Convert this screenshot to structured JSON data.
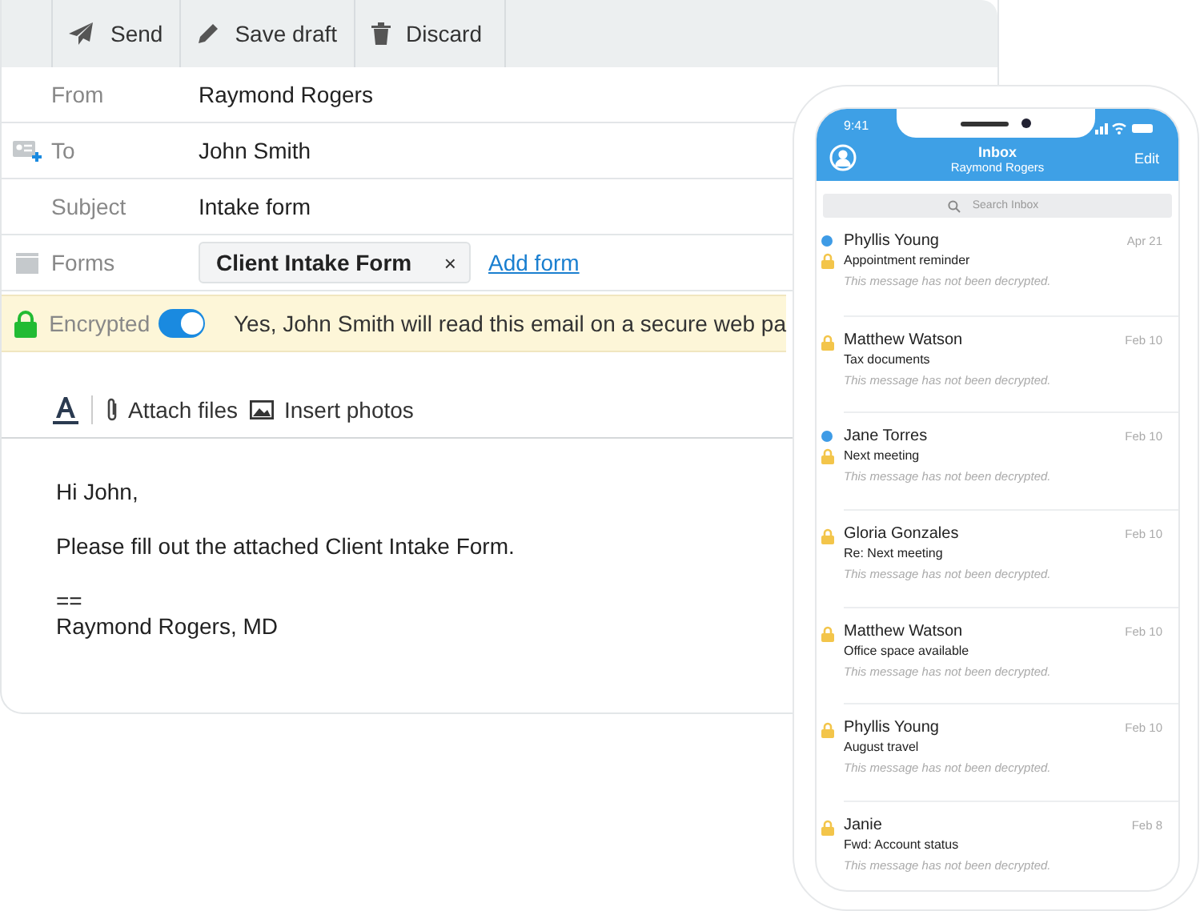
{
  "toolbar": [
    {
      "kind": "send",
      "label": "Send"
    },
    {
      "kind": "draft",
      "label": "Save draft"
    },
    {
      "kind": "discard",
      "label": "Discard"
    }
  ],
  "fields": [
    {
      "kind": "from",
      "label": "From",
      "value": "Raymond Rogers"
    },
    {
      "kind": "to",
      "label": "To",
      "value": "John Smith"
    },
    {
      "kind": "subject",
      "label": "Subject",
      "value": "Intake form"
    }
  ],
  "forms": {
    "label": "Forms",
    "chip": "Client Intake Form",
    "remove": "×",
    "link": "Add form"
  },
  "encryption": {
    "label": "Encrypted",
    "on": true,
    "message": "Yes, John Smith will read this email on a secure web pa"
  },
  "format_bar": {
    "attach": "Attach files",
    "photos": "Insert photos"
  },
  "body": [
    "Hi John,",
    "Please fill out the attached Client Intake Form.",
    "==\nRaymond Rogers, MD"
  ],
  "phone": {
    "time": "9:41",
    "title": "Inbox",
    "subtitle": "Raymond Rogers",
    "edit": "Edit",
    "search": {
      "placeholder": "Search Inbox"
    },
    "messages": [
      {
        "sender": "Phyllis Young",
        "subject": "Appointment reminder",
        "preview": "This message has not been decrypted.",
        "date": "Apr 21",
        "unread": true
      },
      {
        "sender": "Matthew Watson",
        "subject": "Tax documents",
        "preview": "This message has not been decrypted.",
        "date": "Feb 10",
        "unread": false
      },
      {
        "sender": "Jane Torres",
        "subject": "Next meeting",
        "preview": "This message has not been decrypted.",
        "date": "Feb 10",
        "unread": true
      },
      {
        "sender": "Gloria Gonzales",
        "subject": "Re: Next meeting",
        "preview": "This message has not been decrypted.",
        "date": "Feb 10",
        "unread": false
      },
      {
        "sender": "Matthew Watson",
        "subject": "Office space available",
        "preview": "This message has not been decrypted.",
        "date": "Feb 10",
        "unread": false
      },
      {
        "sender": "Phyllis Young",
        "subject": "August travel",
        "preview": "This message has not been decrypted.",
        "date": "Feb 10",
        "unread": false
      },
      {
        "sender": "Janie",
        "subject": "Fwd: Account status",
        "preview": "This message has not been decrypted.",
        "date": "Feb 8",
        "unread": false
      }
    ]
  }
}
